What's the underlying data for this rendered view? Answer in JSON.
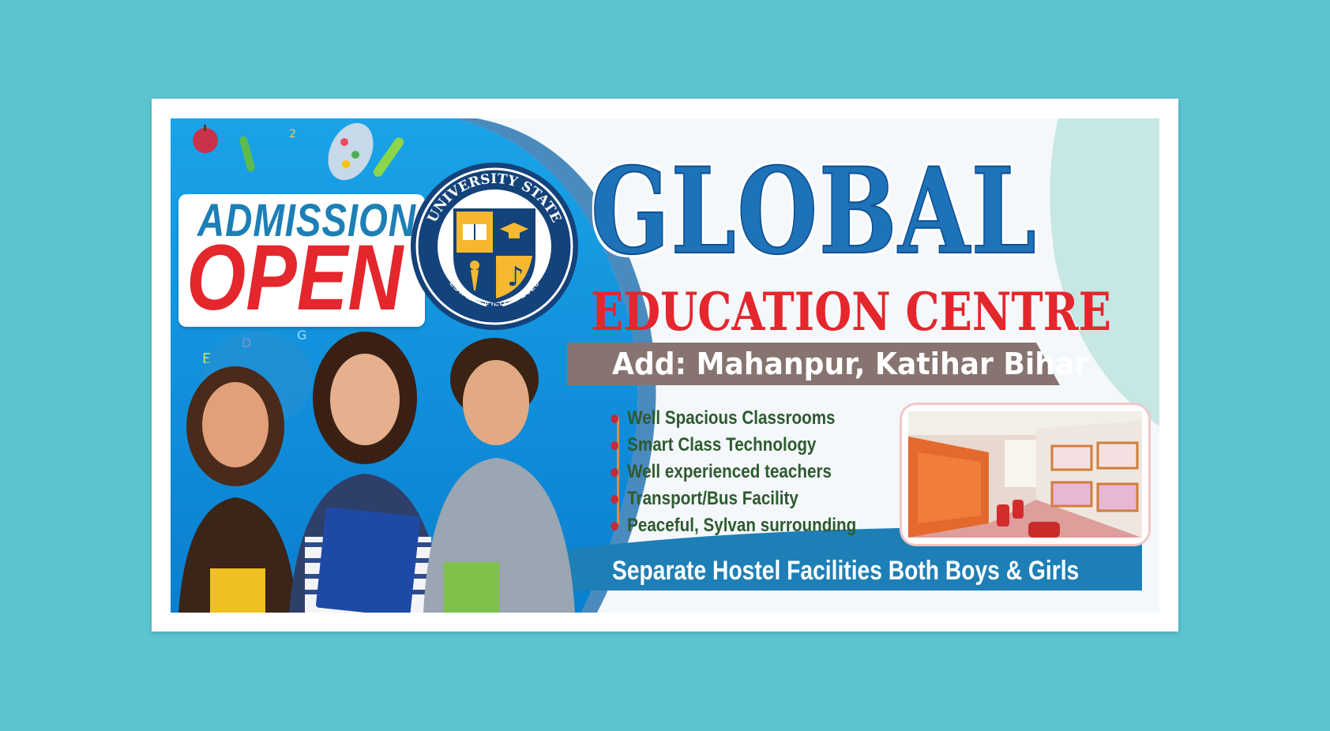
{
  "banner": {
    "admission_label": "ADMISSION",
    "open_label": "OPEN",
    "seal": {
      "top_text": "UNIVERSITY STATE",
      "bottom_text": "ESTABLISHED IN 2020"
    },
    "brand_title": "GLOBAL",
    "brand_subtitle": "EDUCATION CENTRE",
    "address": "Add: Mahanpur, Katihar Bihar",
    "features": [
      "Well Spacious Classrooms",
      "Smart Class Technology",
      "Well experienced teachers",
      "Transport/Bus Facility",
      "Peaceful, Sylvan surrounding"
    ],
    "hostel_tagline": "Separate Hostel Facilities Both Boys & Girls"
  },
  "colors": {
    "page_background": "#5bc4cf",
    "brand_blue": "#1e72b8",
    "accent_red": "#e4262d",
    "address_bar": "#877470",
    "feature_text": "#2e5a2f",
    "bottom_bar": "#1d7fb6"
  },
  "icons": [
    "book-icon",
    "graduation-cap-icon",
    "torch-icon",
    "music-note-icon",
    "laurel-icon",
    "apple-icon",
    "palette-icon",
    "test-tube-icon"
  ]
}
